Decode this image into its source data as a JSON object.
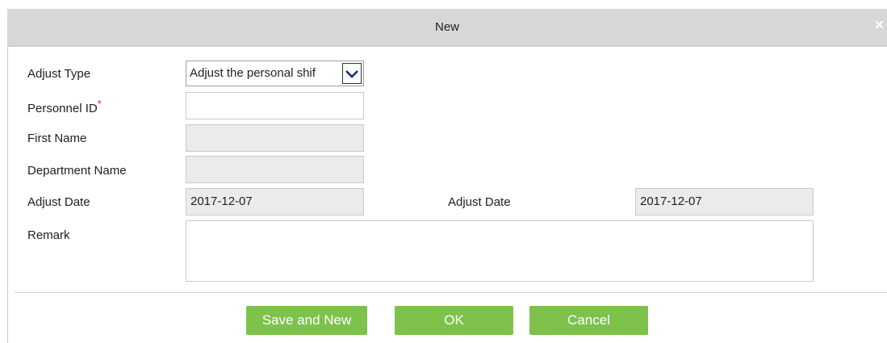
{
  "dialog": {
    "title": "New",
    "close_label": "×"
  },
  "form": {
    "adjust_type_label": "Adjust Type",
    "adjust_type_value": "Adjust the personal shif",
    "personnel_id_label": "Personnel ID",
    "required_mark": "*",
    "personnel_id_value": "",
    "first_name_label": "First Name",
    "first_name_value": "",
    "department_name_label": "Department Name",
    "department_name_value": "",
    "adjust_date_label": "Adjust Date",
    "adjust_date_value": "2017-12-07",
    "adjust_date2_label": "Adjust Date",
    "adjust_date2_value": "2017-12-07",
    "remark_label": "Remark",
    "remark_value": ""
  },
  "buttons": {
    "save_and_new": "Save and New",
    "ok": "OK",
    "cancel": "Cancel"
  },
  "colors": {
    "button_green": "#7dc24b",
    "titlebar_gray": "#d7d7d7",
    "readonly_gray": "#ebebeb",
    "required_red": "#d9261c"
  }
}
